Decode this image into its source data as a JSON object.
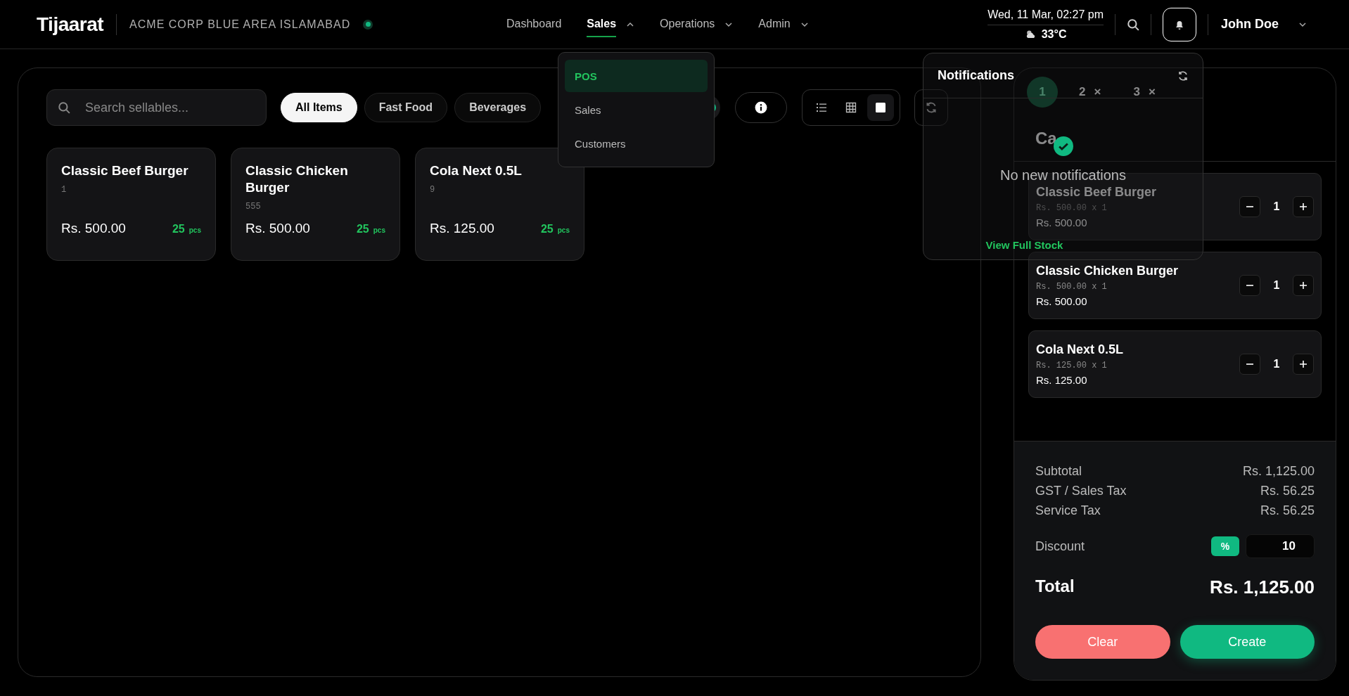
{
  "header": {
    "brand": "Tijaarat",
    "location": "ACME CORP BLUE AREA ISLAMABAD",
    "online": true,
    "nav": [
      {
        "label": "Dashboard",
        "selected": false,
        "has_menu": false
      },
      {
        "label": "Sales",
        "selected": true,
        "has_menu": true,
        "expanded": true
      },
      {
        "label": "Operations",
        "selected": false,
        "has_menu": true,
        "expanded": false
      },
      {
        "label": "Admin",
        "selected": false,
        "has_menu": true,
        "expanded": false
      }
    ],
    "datetime": "Wed, 11 Mar, 02:27 pm",
    "weather": "33°C",
    "user": "John Doe"
  },
  "sales_menu": [
    {
      "label": "POS",
      "selected": true
    },
    {
      "label": "Sales",
      "selected": false
    },
    {
      "label": "Customers",
      "selected": false
    }
  ],
  "search": {
    "placeholder": "Search sellables..."
  },
  "categories": [
    {
      "label": "All Items",
      "selected": true
    },
    {
      "label": "Fast Food",
      "selected": false
    },
    {
      "label": "Beverages",
      "selected": false
    }
  ],
  "toggle": {
    "on": true
  },
  "view_modes": [
    {
      "kind": "list",
      "selected": false
    },
    {
      "kind": "grid",
      "selected": false
    },
    {
      "kind": "tile",
      "selected": true
    }
  ],
  "products": [
    {
      "name": "Classic Beef Burger",
      "code": "1",
      "price": "Rs. 500.00",
      "stock": "25",
      "unit": "pcs"
    },
    {
      "name": "Classic Chicken Burger",
      "code": "555",
      "price": "Rs. 500.00",
      "stock": "25",
      "unit": "pcs"
    },
    {
      "name": "Cola Next 0.5L",
      "code": "9",
      "price": "Rs. 125.00",
      "stock": "25",
      "unit": "pcs"
    }
  ],
  "notifications": {
    "title": "Notifications",
    "empty_text": "No new notifications",
    "link": "View Full Stock"
  },
  "cart": {
    "tabs": [
      {
        "label": "1",
        "selected": true
      },
      {
        "label": "2",
        "selected": false,
        "close": "×"
      },
      {
        "label": "3",
        "selected": false,
        "close": "×"
      }
    ],
    "title": "Ca",
    "items": [
      {
        "name": "Classic Beef Burger",
        "unit_line": "Rs. 500.00 x 1",
        "total": "Rs. 500.00",
        "qty": "1"
      },
      {
        "name": "Classic Chicken Burger",
        "unit_line": "Rs. 500.00 x 1",
        "total": "Rs. 500.00",
        "qty": "1"
      },
      {
        "name": "Cola Next 0.5L",
        "unit_line": "Rs. 125.00 x 1",
        "total": "Rs. 125.00",
        "qty": "1"
      }
    ],
    "summary": [
      {
        "label": "Subtotal",
        "value": "Rs. 1,125.00"
      },
      {
        "label": "GST / Sales Tax",
        "value": "Rs. 56.25"
      },
      {
        "label": "Service Tax",
        "value": "Rs. 56.25"
      }
    ],
    "discount": {
      "label": "Discount",
      "mode": "%",
      "value": "10"
    },
    "total": {
      "label": "Total",
      "value": "Rs. 1,125.00"
    },
    "actions": [
      {
        "label": "Clear",
        "kind": "danger"
      },
      {
        "label": "Create",
        "kind": "primary"
      }
    ]
  }
}
